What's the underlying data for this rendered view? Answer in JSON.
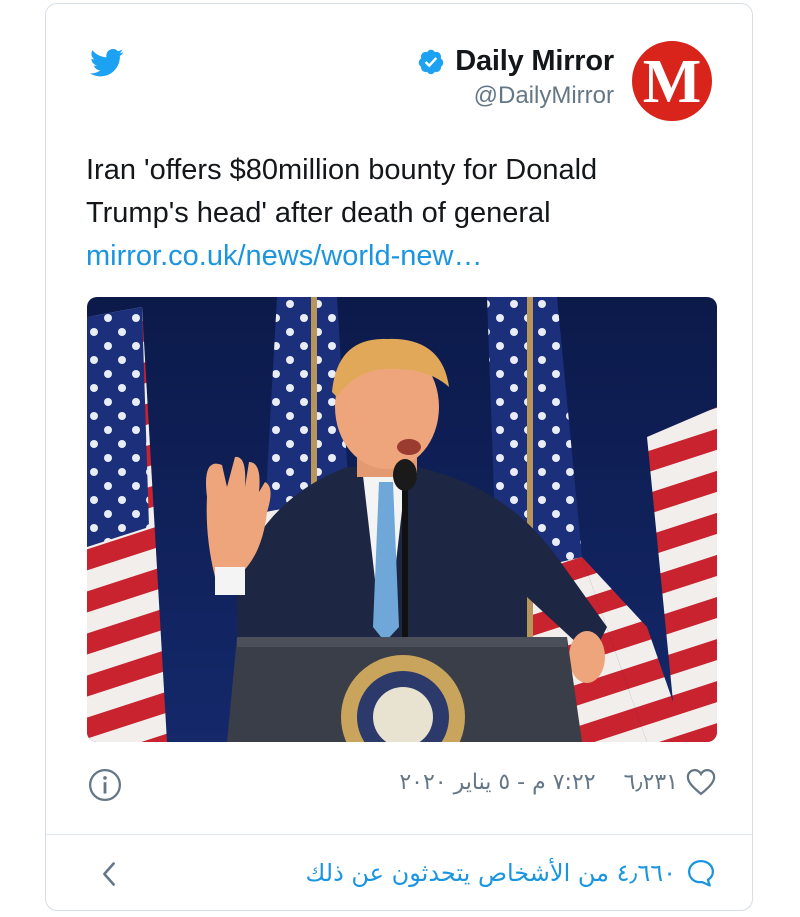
{
  "source": {
    "icon": "twitter-bird-icon",
    "brand_color": "#1da1f2"
  },
  "author": {
    "display_name": "Daily Mirror",
    "handle": "@DailyMirror",
    "verified_icon": "verified-badge-icon",
    "avatar_letter": "M",
    "avatar_color": "#d9241b"
  },
  "tweet": {
    "text": "Iran 'offers $80million bounty for Donald Trump's head' after death of general",
    "link": "mirror.co.uk/news/world-new…",
    "link_color": "#1b95e0"
  },
  "media": {
    "image_id": "speaker-photo"
  },
  "meta": {
    "info_icon": "info-icon",
    "timestamp": "٧:٢٢ م - ٥ يناير ٢٠٢٠",
    "like_count": "٦٫٢٣١",
    "like_icon": "heart-icon"
  },
  "footer": {
    "talking_text": "٤٫٦٦٠ من الأشخاص يتحدثون عن ذلك",
    "talk_icon": "speech-bubble-icon",
    "chevron_icon": "chevron-left-icon"
  }
}
